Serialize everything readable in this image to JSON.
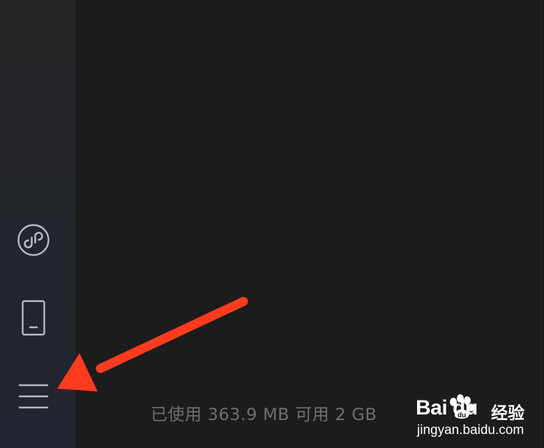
{
  "sidebar": {
    "items": [
      {
        "name": "mini-program-icon"
      },
      {
        "name": "phone-device-icon"
      },
      {
        "name": "hamburger-menu-icon"
      }
    ]
  },
  "status": {
    "storage_text": "已使用 363.9 MB 可用 2 GB"
  },
  "annotation": {
    "arrow_color": "#ff3b1f"
  },
  "watermark": {
    "logo_text": "Bai du",
    "cn_text": "经验",
    "url": "jingyan.baidu.com"
  },
  "colors": {
    "sidebar_bg": "#23262b",
    "main_bg": "#1c1c1d",
    "icon_stroke": "#b9bcc2",
    "status_text": "#6f6f72"
  }
}
